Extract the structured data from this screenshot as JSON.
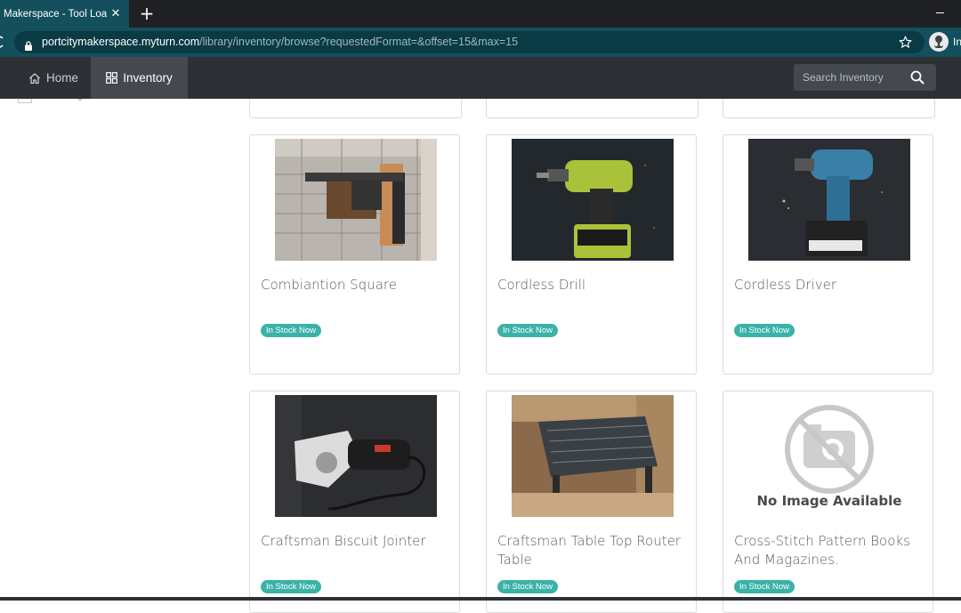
{
  "browser": {
    "tab_title": "Makerspace - Tool Loan",
    "tab_close": "✕",
    "new_tab": "+",
    "url_host": "portcitymakerspace.myturn.com",
    "url_path": "/library/inventory/browse?requestedFormat=&offset=15&max=15",
    "profile_label": "In"
  },
  "nav": {
    "home_label": "Home",
    "inventory_label": "Inventory",
    "search_placeholder": "Search Inventory"
  },
  "colors": {
    "tab_active": "#134f5c",
    "nav_bg": "#2d3034",
    "badge": "#3ab3a6"
  },
  "items": [
    {
      "title": "Combiantion Square",
      "status": "In Stock Now",
      "image": "photo"
    },
    {
      "title": "Cordless Drill",
      "status": "In Stock Now",
      "image": "photo"
    },
    {
      "title": "Cordless Driver",
      "status": "In Stock Now",
      "image": "photo"
    },
    {
      "title": "Craftsman Biscuit Jointer",
      "status": "In Stock Now",
      "image": "photo"
    },
    {
      "title": "Craftsman Table Top Router Table",
      "status": "In Stock Now",
      "image": "photo"
    },
    {
      "title": "Cross-Stitch Pattern Books And Magazines.",
      "status": "In Stock Now",
      "image": "none",
      "no_image_text": "No Image Available"
    }
  ]
}
